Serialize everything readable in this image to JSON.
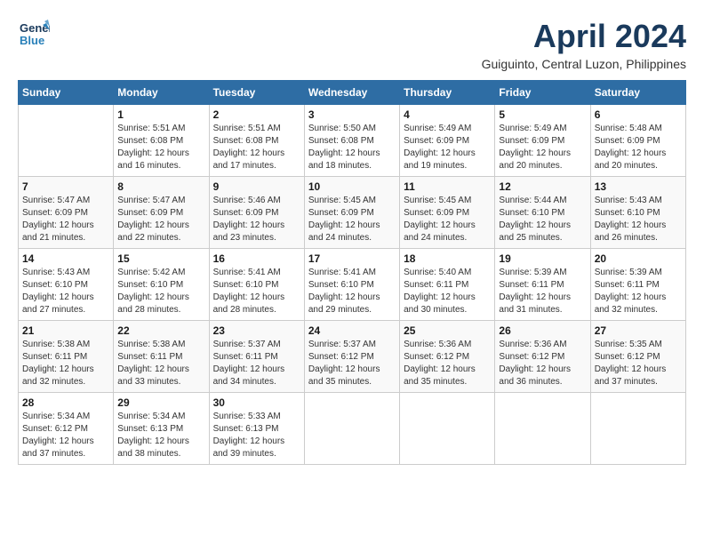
{
  "logo": {
    "line1": "General",
    "line2": "Blue"
  },
  "header": {
    "month": "April 2024",
    "location": "Guiguinto, Central Luzon, Philippines"
  },
  "weekdays": [
    "Sunday",
    "Monday",
    "Tuesday",
    "Wednesday",
    "Thursday",
    "Friday",
    "Saturday"
  ],
  "weeks": [
    [
      {
        "day": "",
        "info": ""
      },
      {
        "day": "1",
        "info": "Sunrise: 5:51 AM\nSunset: 6:08 PM\nDaylight: 12 hours\nand 16 minutes."
      },
      {
        "day": "2",
        "info": "Sunrise: 5:51 AM\nSunset: 6:08 PM\nDaylight: 12 hours\nand 17 minutes."
      },
      {
        "day": "3",
        "info": "Sunrise: 5:50 AM\nSunset: 6:08 PM\nDaylight: 12 hours\nand 18 minutes."
      },
      {
        "day": "4",
        "info": "Sunrise: 5:49 AM\nSunset: 6:09 PM\nDaylight: 12 hours\nand 19 minutes."
      },
      {
        "day": "5",
        "info": "Sunrise: 5:49 AM\nSunset: 6:09 PM\nDaylight: 12 hours\nand 20 minutes."
      },
      {
        "day": "6",
        "info": "Sunrise: 5:48 AM\nSunset: 6:09 PM\nDaylight: 12 hours\nand 20 minutes."
      }
    ],
    [
      {
        "day": "7",
        "info": "Sunrise: 5:47 AM\nSunset: 6:09 PM\nDaylight: 12 hours\nand 21 minutes."
      },
      {
        "day": "8",
        "info": "Sunrise: 5:47 AM\nSunset: 6:09 PM\nDaylight: 12 hours\nand 22 minutes."
      },
      {
        "day": "9",
        "info": "Sunrise: 5:46 AM\nSunset: 6:09 PM\nDaylight: 12 hours\nand 23 minutes."
      },
      {
        "day": "10",
        "info": "Sunrise: 5:45 AM\nSunset: 6:09 PM\nDaylight: 12 hours\nand 24 minutes."
      },
      {
        "day": "11",
        "info": "Sunrise: 5:45 AM\nSunset: 6:09 PM\nDaylight: 12 hours\nand 24 minutes."
      },
      {
        "day": "12",
        "info": "Sunrise: 5:44 AM\nSunset: 6:10 PM\nDaylight: 12 hours\nand 25 minutes."
      },
      {
        "day": "13",
        "info": "Sunrise: 5:43 AM\nSunset: 6:10 PM\nDaylight: 12 hours\nand 26 minutes."
      }
    ],
    [
      {
        "day": "14",
        "info": "Sunrise: 5:43 AM\nSunset: 6:10 PM\nDaylight: 12 hours\nand 27 minutes."
      },
      {
        "day": "15",
        "info": "Sunrise: 5:42 AM\nSunset: 6:10 PM\nDaylight: 12 hours\nand 28 minutes."
      },
      {
        "day": "16",
        "info": "Sunrise: 5:41 AM\nSunset: 6:10 PM\nDaylight: 12 hours\nand 28 minutes."
      },
      {
        "day": "17",
        "info": "Sunrise: 5:41 AM\nSunset: 6:10 PM\nDaylight: 12 hours\nand 29 minutes."
      },
      {
        "day": "18",
        "info": "Sunrise: 5:40 AM\nSunset: 6:11 PM\nDaylight: 12 hours\nand 30 minutes."
      },
      {
        "day": "19",
        "info": "Sunrise: 5:39 AM\nSunset: 6:11 PM\nDaylight: 12 hours\nand 31 minutes."
      },
      {
        "day": "20",
        "info": "Sunrise: 5:39 AM\nSunset: 6:11 PM\nDaylight: 12 hours\nand 32 minutes."
      }
    ],
    [
      {
        "day": "21",
        "info": "Sunrise: 5:38 AM\nSunset: 6:11 PM\nDaylight: 12 hours\nand 32 minutes."
      },
      {
        "day": "22",
        "info": "Sunrise: 5:38 AM\nSunset: 6:11 PM\nDaylight: 12 hours\nand 33 minutes."
      },
      {
        "day": "23",
        "info": "Sunrise: 5:37 AM\nSunset: 6:11 PM\nDaylight: 12 hours\nand 34 minutes."
      },
      {
        "day": "24",
        "info": "Sunrise: 5:37 AM\nSunset: 6:12 PM\nDaylight: 12 hours\nand 35 minutes."
      },
      {
        "day": "25",
        "info": "Sunrise: 5:36 AM\nSunset: 6:12 PM\nDaylight: 12 hours\nand 35 minutes."
      },
      {
        "day": "26",
        "info": "Sunrise: 5:36 AM\nSunset: 6:12 PM\nDaylight: 12 hours\nand 36 minutes."
      },
      {
        "day": "27",
        "info": "Sunrise: 5:35 AM\nSunset: 6:12 PM\nDaylight: 12 hours\nand 37 minutes."
      }
    ],
    [
      {
        "day": "28",
        "info": "Sunrise: 5:34 AM\nSunset: 6:12 PM\nDaylight: 12 hours\nand 37 minutes."
      },
      {
        "day": "29",
        "info": "Sunrise: 5:34 AM\nSunset: 6:13 PM\nDaylight: 12 hours\nand 38 minutes."
      },
      {
        "day": "30",
        "info": "Sunrise: 5:33 AM\nSunset: 6:13 PM\nDaylight: 12 hours\nand 39 minutes."
      },
      {
        "day": "",
        "info": ""
      },
      {
        "day": "",
        "info": ""
      },
      {
        "day": "",
        "info": ""
      },
      {
        "day": "",
        "info": ""
      }
    ]
  ]
}
